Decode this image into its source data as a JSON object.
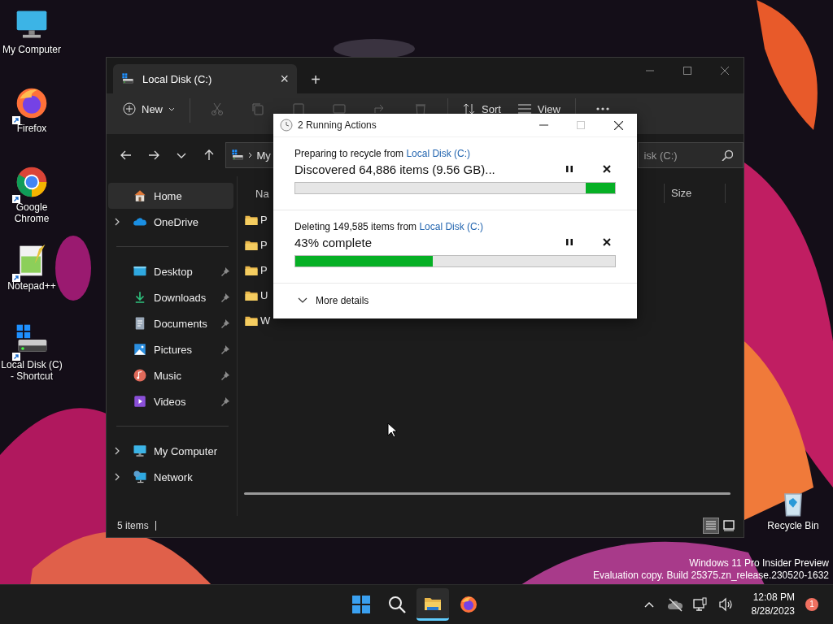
{
  "desktop_icons": [
    {
      "kind": "computer",
      "label": "My Computer",
      "shortcut": false
    },
    {
      "kind": "firefox",
      "label": "Firefox",
      "shortcut": true
    },
    {
      "kind": "chrome",
      "label": "Google Chrome",
      "shortcut": true
    },
    {
      "kind": "notepad",
      "label": "Notepad++",
      "shortcut": true
    },
    {
      "kind": "disk",
      "label": "Local Disk (C) - Shortcut",
      "shortcut": true
    }
  ],
  "recycle_bin": {
    "label": "Recycle Bin"
  },
  "explorer": {
    "tab": {
      "title": "Local Disk (C:)",
      "close": "×"
    },
    "new_tab": "+",
    "toolbar": {
      "new": "New",
      "sort": "Sort",
      "view": "View"
    },
    "address": {
      "crumb": "My"
    },
    "search": {
      "placeholder": "isk (C:)"
    },
    "sidebar": [
      [
        {
          "kind": "home",
          "label": "Home",
          "selected": true,
          "expandable": false,
          "pinned": false
        },
        {
          "kind": "cloud",
          "label": "OneDrive",
          "selected": false,
          "expandable": true,
          "pinned": false
        }
      ],
      [
        {
          "kind": "desktop",
          "label": "Desktop",
          "selected": false,
          "expandable": false,
          "pinned": true
        },
        {
          "kind": "download",
          "label": "Downloads",
          "selected": false,
          "expandable": false,
          "pinned": true
        },
        {
          "kind": "document",
          "label": "Documents",
          "selected": false,
          "expandable": false,
          "pinned": true
        },
        {
          "kind": "picture",
          "label": "Pictures",
          "selected": false,
          "expandable": false,
          "pinned": true
        },
        {
          "kind": "music",
          "label": "Music",
          "selected": false,
          "expandable": false,
          "pinned": true
        },
        {
          "kind": "video",
          "label": "Videos",
          "selected": false,
          "expandable": false,
          "pinned": true
        }
      ],
      [
        {
          "kind": "computer",
          "label": "My Computer",
          "selected": false,
          "expandable": true,
          "pinned": false
        },
        {
          "kind": "network",
          "label": "Network",
          "selected": false,
          "expandable": true,
          "pinned": false
        }
      ]
    ],
    "columns": [
      "Na",
      "Size"
    ],
    "rows": [
      {
        "name": "P"
      },
      {
        "name": "P"
      },
      {
        "name": "P"
      },
      {
        "name": "U"
      },
      {
        "name": "W"
      }
    ],
    "status": "5 items",
    "views": [
      {
        "kind": "details",
        "selected": true
      },
      {
        "kind": "tiles",
        "selected": false
      }
    ]
  },
  "dialog": {
    "title": "2 Running Actions",
    "operations": [
      {
        "kind": "marquee",
        "caption": "Preparing to recycle from ",
        "link": "Local Disk (C:)",
        "status": "Discovered 64,886 items (9.56 GB)..."
      },
      {
        "kind": "determinate",
        "caption": "Deleting 149,585 items from ",
        "link": "Local Disk (C:)",
        "status": "43% complete",
        "level": 0.43
      }
    ],
    "more": "More details"
  },
  "watermark": [
    "Windows 11 Pro Insider Preview",
    "Evaluation copy. Build 25375.zn_release.230520-1632"
  ],
  "taskbar": {
    "apps": [
      {
        "kind": "start",
        "selected": false
      },
      {
        "kind": "search",
        "selected": false
      },
      {
        "kind": "explorer",
        "selected": true
      },
      {
        "kind": "firefox",
        "selected": false
      }
    ],
    "time": "12:08 PM",
    "date": "8/28/2023",
    "badge": "1"
  }
}
